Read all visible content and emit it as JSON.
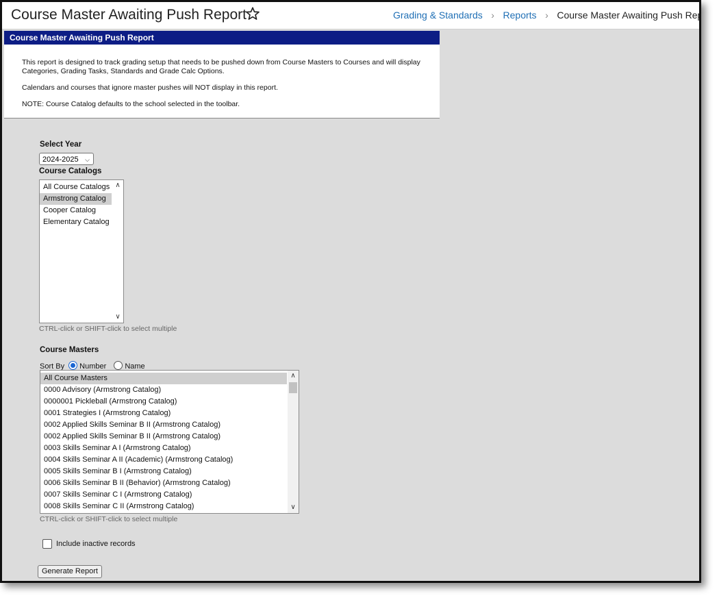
{
  "header": {
    "title": "Course Master Awaiting Push Report",
    "breadcrumb": [
      "Grading & Standards",
      "Reports",
      "Course Master Awaiting Push Report"
    ]
  },
  "panel": {
    "header": "Course Master Awaiting Push Report",
    "paragraphs": [
      "This report is designed to track grading setup that needs to be pushed down from Course Masters to Courses and will display Categories, Grading Tasks, Standards and Grade Calc Options.",
      "Calendars and courses that ignore master pushes will NOT display in this report.",
      "NOTE: Course Catalog defaults to the school selected in the toolbar."
    ]
  },
  "form": {
    "year_label": "Select Year",
    "year_value": "2024-2025",
    "catalogs_label": "Course Catalogs",
    "catalogs": [
      {
        "label": "All Course Catalogs",
        "selected": false
      },
      {
        "label": "Armstrong Catalog",
        "selected": true
      },
      {
        "label": "Cooper Catalog",
        "selected": false
      },
      {
        "label": "Elementary Catalog",
        "selected": false
      }
    ],
    "catalogs_hint": "CTRL-click or SHIFT-click to select multiple",
    "masters_label": "Course Masters",
    "sort_label": "Sort By",
    "sort_number": "Number",
    "sort_name": "Name",
    "sort_selected": "Number",
    "masters": [
      {
        "label": "All Course Masters",
        "selected": true
      },
      {
        "label": "0000 Advisory (Armstrong Catalog)",
        "selected": false
      },
      {
        "label": "0000001 Pickleball (Armstrong Catalog)",
        "selected": false
      },
      {
        "label": "0001 Strategies I (Armstrong Catalog)",
        "selected": false
      },
      {
        "label": "0002 Applied Skills Seminar B II (Armstrong Catalog)",
        "selected": false
      },
      {
        "label": "0002 Applied Skills Seminar B II (Armstrong Catalog)",
        "selected": false
      },
      {
        "label": "0003 Skills Seminar A I (Armstrong Catalog)",
        "selected": false
      },
      {
        "label": "0004 Skills Seminar A II (Academic) (Armstrong Catalog)",
        "selected": false
      },
      {
        "label": "0005 Skills Seminar B I (Armstrong Catalog)",
        "selected": false
      },
      {
        "label": "0006 Skills Seminar B II (Behavior) (Armstrong Catalog)",
        "selected": false
      },
      {
        "label": "0007 Skills Seminar C I (Armstrong Catalog)",
        "selected": false
      },
      {
        "label": "0008 Skills Seminar C II (Armstrong Catalog)",
        "selected": false
      }
    ],
    "masters_hint": "CTRL-click or SHIFT-click to select multiple",
    "inactive_label": "Include inactive records",
    "inactive_checked": false,
    "generate_button": "Generate Report"
  },
  "colors": {
    "panel_header_bg": "#0d1d85",
    "link": "#1f6fb5",
    "radio_accent": "#1a66d2",
    "page_bg": "#dcdcdc"
  },
  "icons": {
    "favorite": "star-outline-icon",
    "breadcrumb_separator": "chevron-right-icon",
    "select_arrow": "chevron-down-icon"
  }
}
